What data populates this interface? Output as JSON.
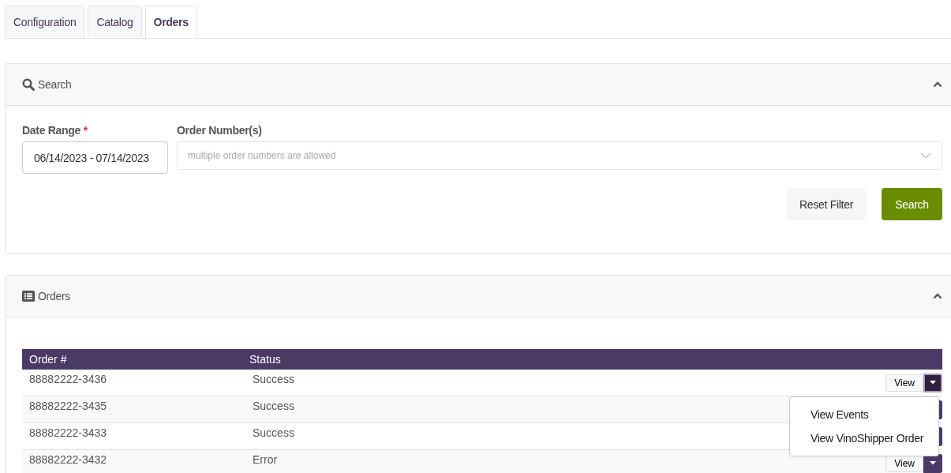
{
  "tabs": [
    {
      "label": "Configuration",
      "selected": false
    },
    {
      "label": "Catalog",
      "selected": false
    },
    {
      "label": "Orders",
      "selected": true
    }
  ],
  "search_panel": {
    "title": "Search",
    "expanded": true,
    "date_range": {
      "label": "Date Range",
      "required_mark": "*",
      "value": "06/14/2023 - 07/14/2023"
    },
    "order_numbers": {
      "label": "Order Number(s)",
      "placeholder": "multiple order numbers are allowed"
    },
    "buttons": [
      {
        "label": "Reset Filter",
        "kind": "secondary"
      },
      {
        "label": "Search",
        "kind": "primary"
      }
    ]
  },
  "orders_panel": {
    "title": "Orders",
    "expanded": true,
    "table": {
      "columns": [
        "Order #",
        "Status"
      ],
      "rows": [
        {
          "order": "88882222-3436",
          "status": "Success",
          "view_label": "View",
          "menu_open": true
        },
        {
          "order": "88882222-3435",
          "status": "Success",
          "menu_open": false
        },
        {
          "order": "88882222-3433",
          "status": "Success",
          "menu_open": false
        },
        {
          "order": "88882222-3432",
          "status": "Error",
          "view_label": "View",
          "menu_open": false
        }
      ]
    },
    "menu": [
      "View Events",
      "View VinoShipper Order"
    ]
  }
}
